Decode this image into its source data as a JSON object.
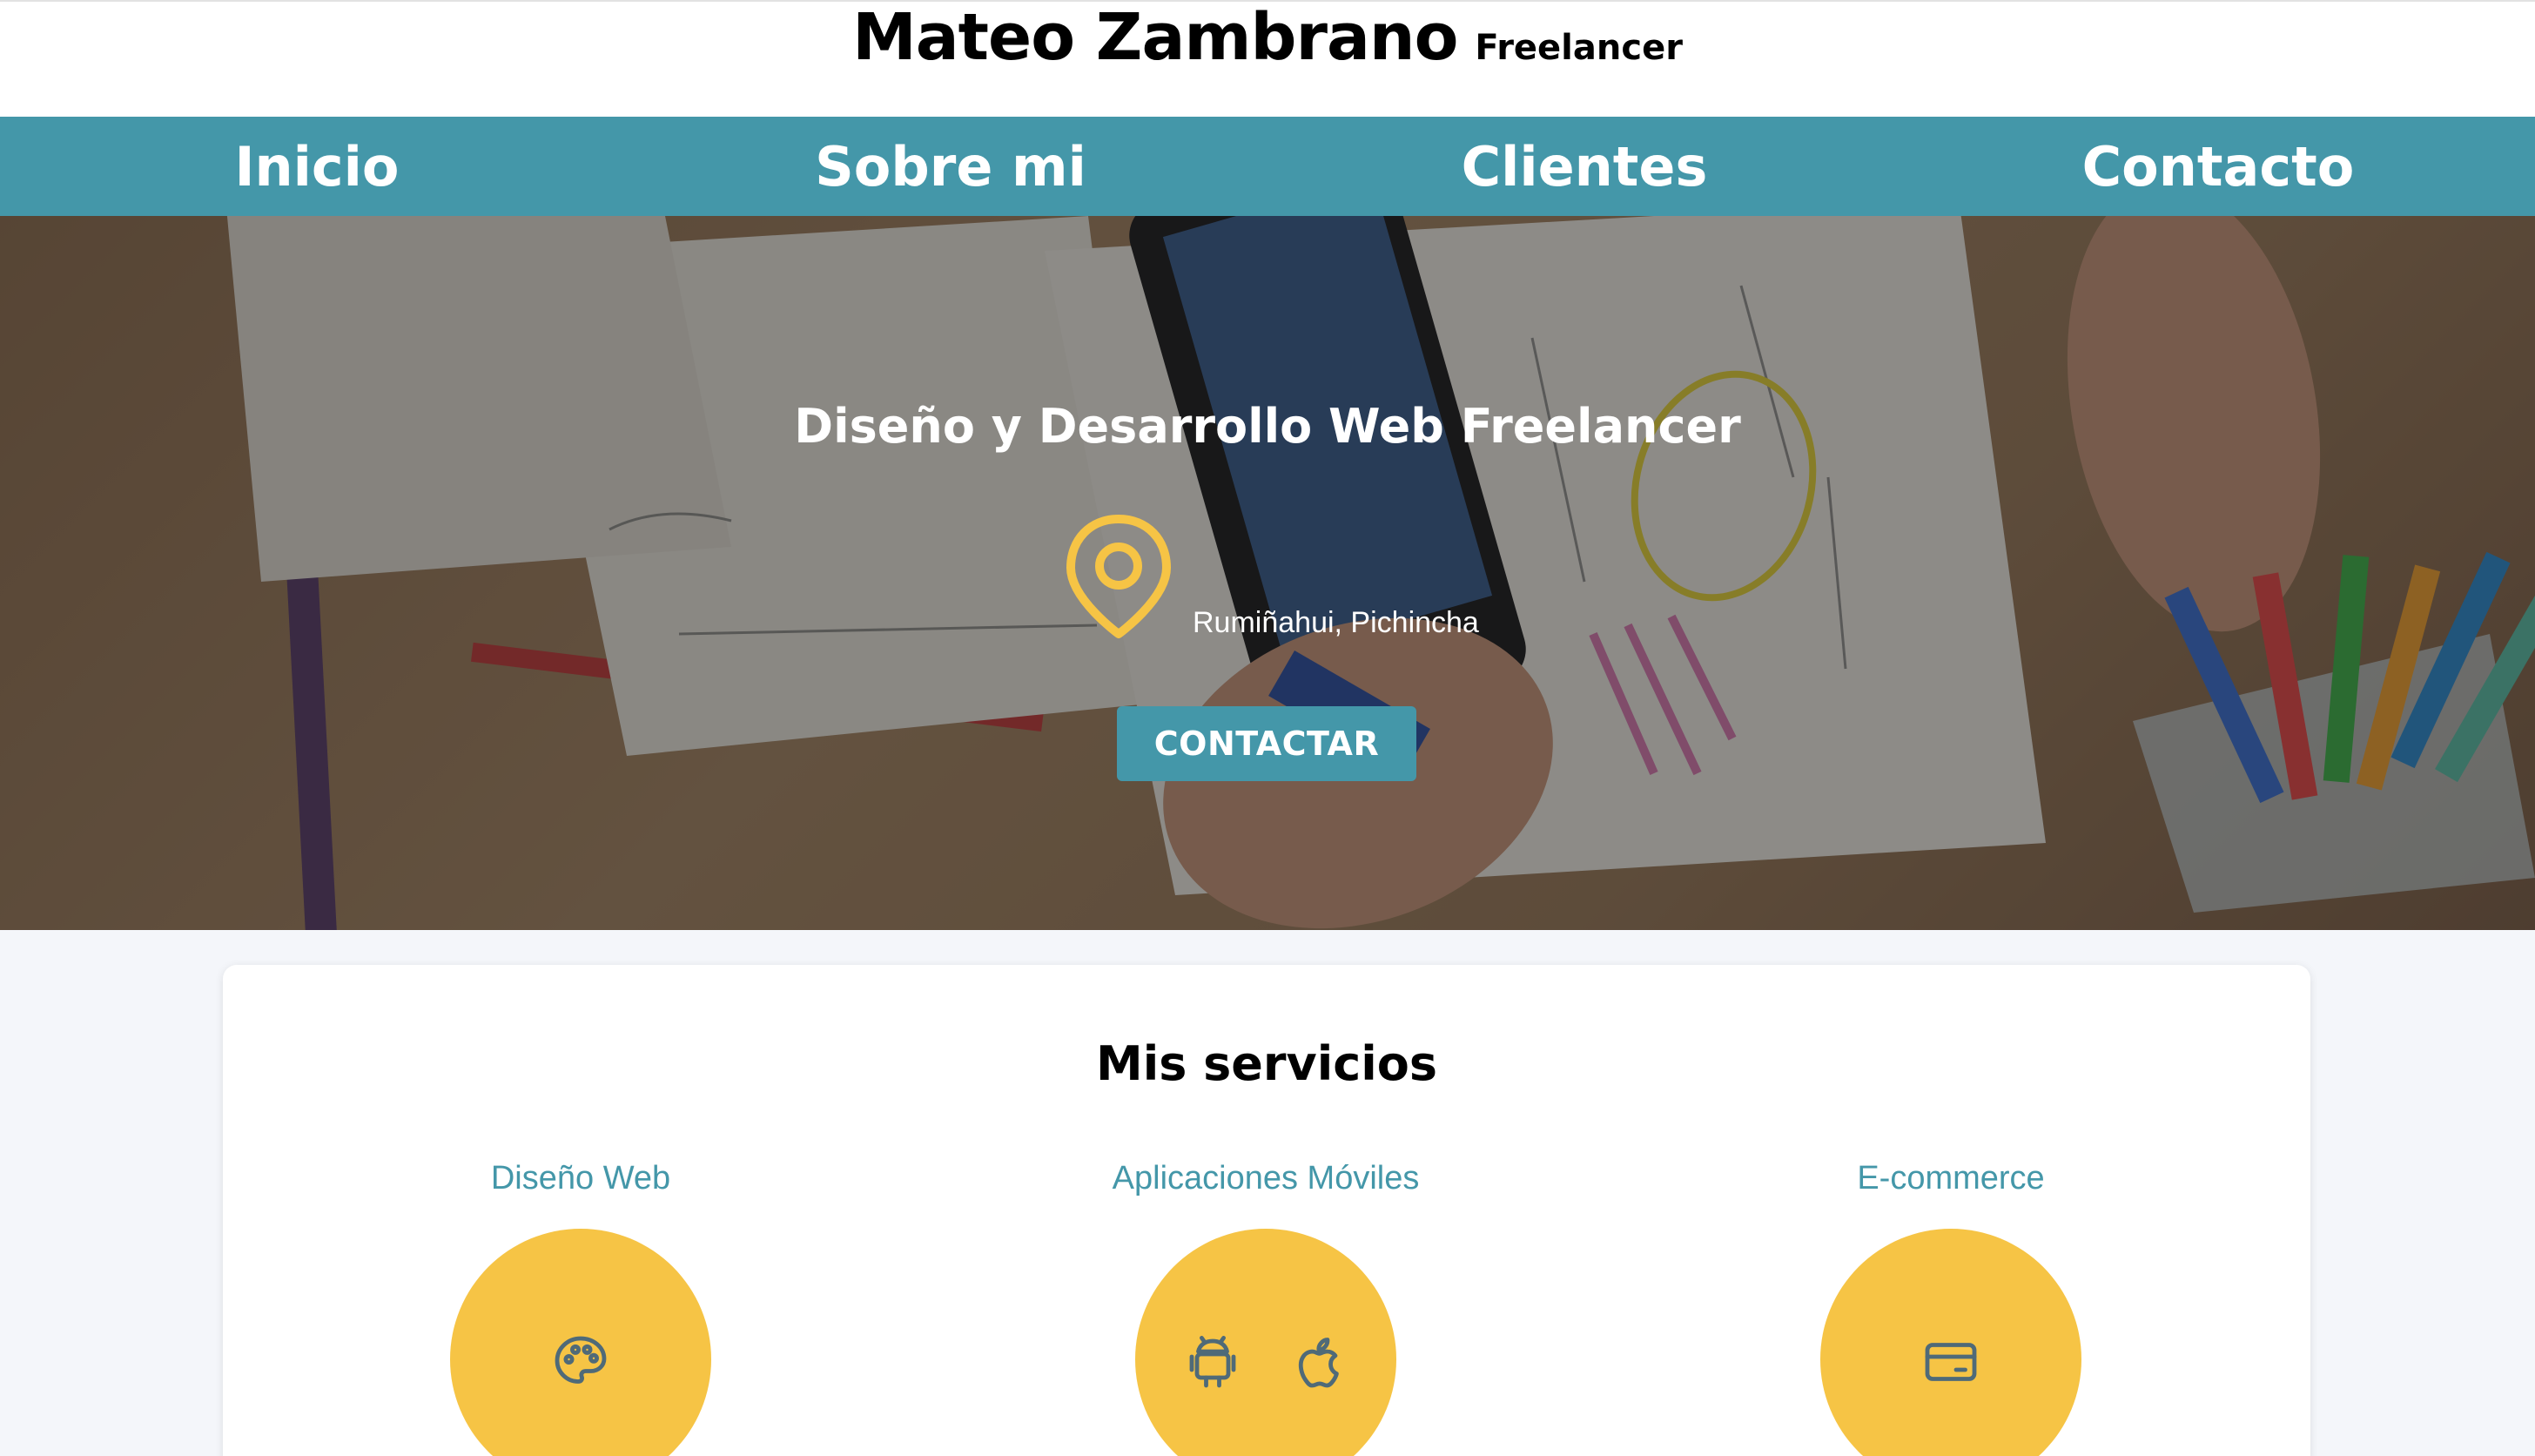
{
  "header": {
    "name": "Mateo Zambrano",
    "tagline": "Freelancer"
  },
  "nav": {
    "items": [
      "Inicio",
      "Sobre mi",
      "Clientes",
      "Contacto"
    ]
  },
  "hero": {
    "title": "Diseño y Desarrollo Web Freelancer",
    "location": "Rumiñahui, Pichincha",
    "location_icon": "map-pin-icon",
    "cta_label": "CONTACTAR"
  },
  "services": {
    "title": "Mis servicios",
    "items": [
      {
        "label": "Diseño Web",
        "icons": [
          "palette-icon"
        ]
      },
      {
        "label": "Aplicaciones Móviles",
        "icons": [
          "android-icon",
          "apple-icon"
        ]
      },
      {
        "label": "E-commerce",
        "icons": [
          "credit-card-icon"
        ]
      }
    ]
  },
  "colors": {
    "accent": "#4497a9",
    "highlight": "#f6c445",
    "icon": "#4f6a78",
    "pin": "#f6c445"
  }
}
